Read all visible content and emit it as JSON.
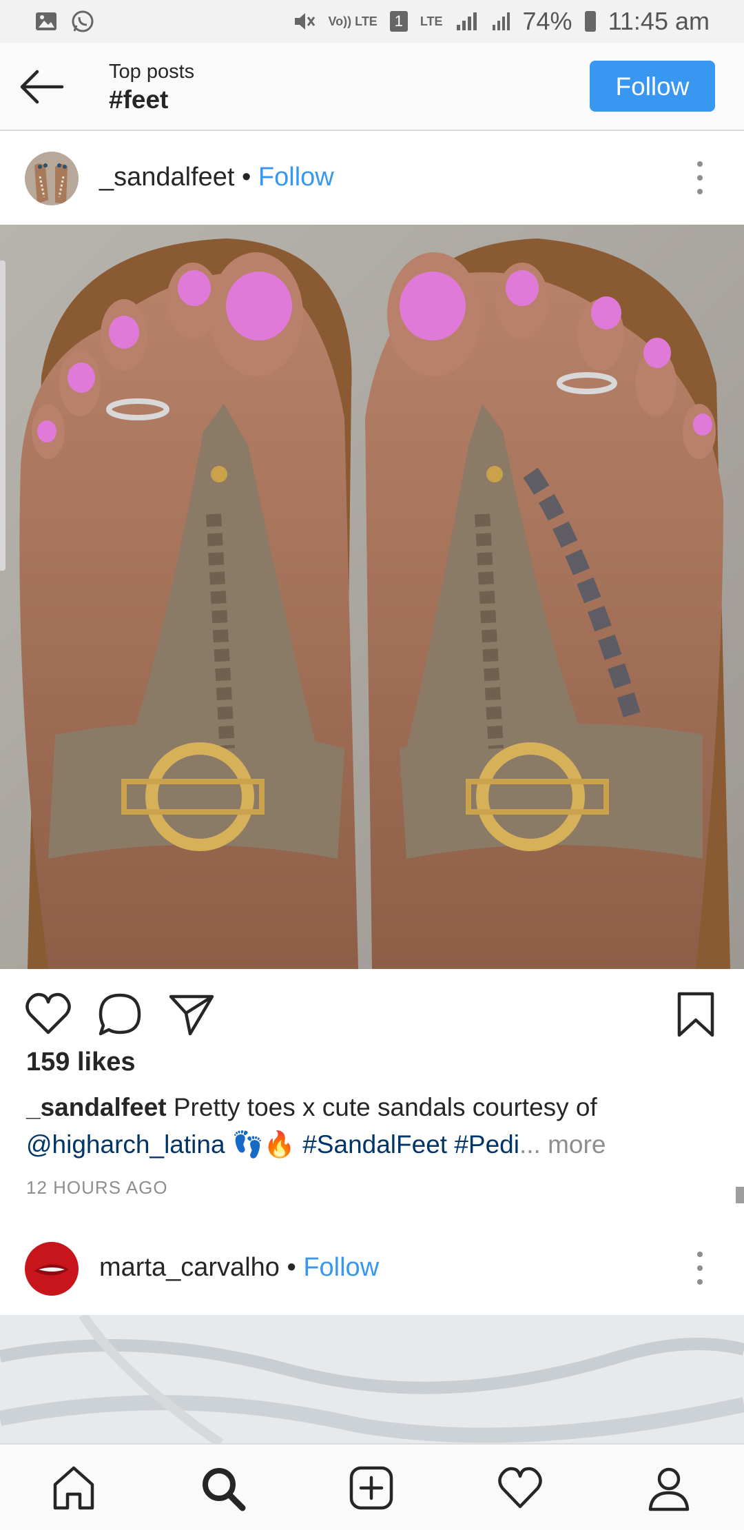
{
  "status_bar": {
    "battery": "74%",
    "time": "11:45 am",
    "sim_indicator": "1",
    "volte_label": "Vo)) LTE",
    "lte_label": "LTE"
  },
  "top_bar": {
    "subtitle": "Top posts",
    "title": "#feet",
    "follow_label": "Follow"
  },
  "posts": [
    {
      "username": "_sandalfeet",
      "separator": " • ",
      "follow_label": "Follow",
      "likes": "159 likes",
      "caption_user": "_sandalfeet",
      "caption_text": " Pretty toes x cute sandals courtesy of ",
      "caption_mention": "@higharch_latina",
      "caption_emoji": " 👣🔥 ",
      "caption_tag1": "#SandalFeet",
      "caption_tag2": "#Pedi",
      "caption_more": "... more",
      "time_ago": "12 HOURS AGO"
    },
    {
      "username": "marta_carvalho",
      "separator": " • ",
      "follow_label": "Follow"
    }
  ],
  "icons": {
    "back": "arrow-left-icon",
    "like": "heart-icon",
    "comment": "comment-icon",
    "share": "send-icon",
    "save": "bookmark-icon",
    "nav": [
      "home-icon",
      "search-icon",
      "add-icon",
      "activity-heart-icon",
      "profile-icon"
    ]
  },
  "colors": {
    "accent": "#3897f0",
    "hashtag": "#003569",
    "muted": "#8e8e8e",
    "nail_polish": "#e07ad8"
  }
}
